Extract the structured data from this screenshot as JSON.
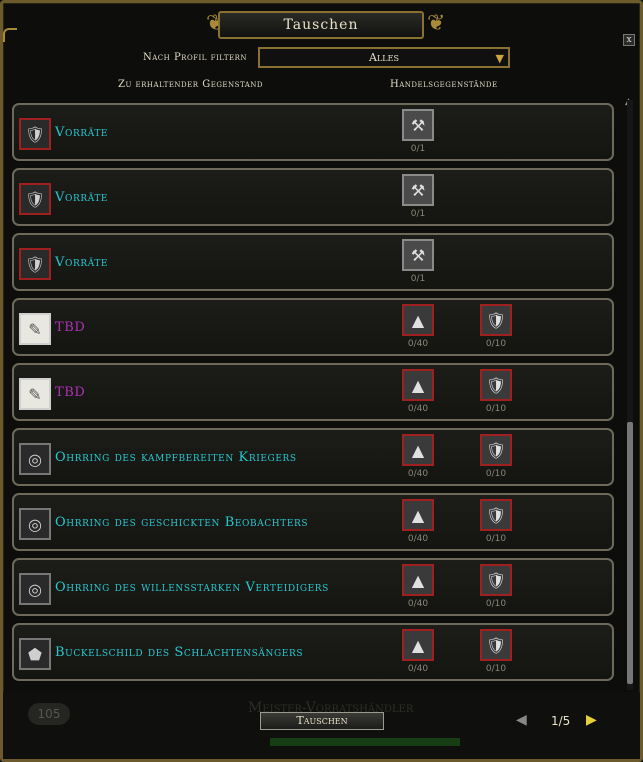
{
  "window": {
    "title": "Tauschen",
    "close_label": "x"
  },
  "filter": {
    "label": "Nach Profil filtern",
    "value": "Alles"
  },
  "columns": {
    "receive": "Zu erhaltender Gegenstand",
    "trade": "Handelsgegenstände"
  },
  "colors": {
    "cyan_item": "#28c8d0",
    "purple_item": "#b030b8",
    "gold_border": "#8a7132"
  },
  "rows": [
    {
      "name": "Vorräte",
      "name_color": "#28c8d0",
      "item_icon": "armor-icon",
      "costs": [
        {
          "icon": "tool-icon",
          "count": "0/1"
        }
      ]
    },
    {
      "name": "Vorräte",
      "name_color": "#28c8d0",
      "item_icon": "armor-icon",
      "costs": [
        {
          "icon": "tool-icon",
          "count": "0/1"
        }
      ]
    },
    {
      "name": "Vorräte",
      "name_color": "#28c8d0",
      "item_icon": "armor-icon",
      "costs": [
        {
          "icon": "tool-icon",
          "count": "0/1"
        }
      ]
    },
    {
      "name": "TBD",
      "name_color": "#b030b8",
      "item_icon": "scroll-icon",
      "costs": [
        {
          "icon": "cloak-icon",
          "count": "0/40"
        },
        {
          "icon": "armor-icon",
          "count": "0/10"
        }
      ]
    },
    {
      "name": "TBD",
      "name_color": "#b030b8",
      "item_icon": "scroll-icon",
      "costs": [
        {
          "icon": "cloak-icon",
          "count": "0/40"
        },
        {
          "icon": "armor-icon",
          "count": "0/10"
        }
      ]
    },
    {
      "name": "Ohrring des kampfbereiten Kriegers",
      "name_color": "#28c8d0",
      "item_icon": "earring-icon",
      "costs": [
        {
          "icon": "cloak-icon",
          "count": "0/40"
        },
        {
          "icon": "armor-icon",
          "count": "0/10"
        }
      ]
    },
    {
      "name": "Ohrring des geschickten Beobachters",
      "name_color": "#28c8d0",
      "item_icon": "earring-icon",
      "costs": [
        {
          "icon": "cloak-icon",
          "count": "0/40"
        },
        {
          "icon": "armor-icon",
          "count": "0/10"
        }
      ]
    },
    {
      "name": "Ohrring des willensstarken Verteidigers",
      "name_color": "#28c8d0",
      "item_icon": "earring-icon",
      "costs": [
        {
          "icon": "cloak-icon",
          "count": "0/40"
        },
        {
          "icon": "armor-icon",
          "count": "0/10"
        }
      ]
    },
    {
      "name": "Buckelschild des Schlachtensängers",
      "name_color": "#28c8d0",
      "item_icon": "shield-icon",
      "costs": [
        {
          "icon": "cloak-icon",
          "count": "0/40"
        },
        {
          "icon": "armor-icon",
          "count": "0/10"
        }
      ]
    }
  ],
  "footer": {
    "trade_button": "Tauschen",
    "page": "1/5"
  },
  "background": {
    "level_badge": "105",
    "npc_text": "Meister-Vorratshändler"
  }
}
